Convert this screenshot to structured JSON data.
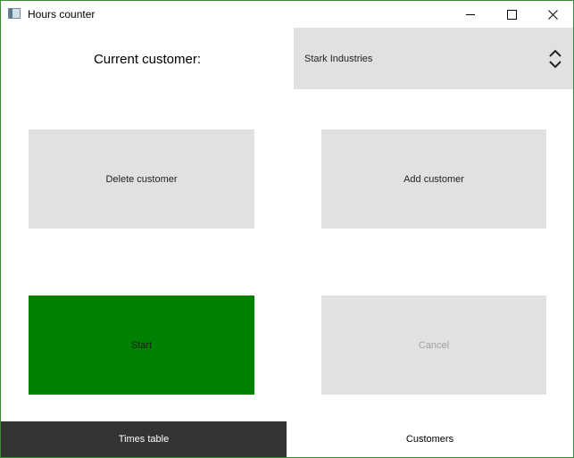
{
  "window": {
    "title": "Hours counter",
    "border_color": "#3a8a3a"
  },
  "window_controls": {
    "minimize_icon": "minimize-icon",
    "maximize_icon": "maximize-icon",
    "close_icon": "close-icon"
  },
  "customer": {
    "label": "Current customer:",
    "selected": "Stark Industries",
    "select_icon": "up-down-arrows-icon"
  },
  "buttons": {
    "delete_label": "Delete customer",
    "add_label": "Add customer",
    "start_label": "Start",
    "cancel_label": "Cancel",
    "start_color": "#008000",
    "button_color": "#e1e1e1",
    "cancel_enabled": false
  },
  "tabs": [
    {
      "label": "Times table",
      "active": true
    },
    {
      "label": "Customers",
      "active": false
    }
  ],
  "colors": {
    "active_tab_bg": "#333333",
    "active_tab_text": "#ffffff"
  }
}
